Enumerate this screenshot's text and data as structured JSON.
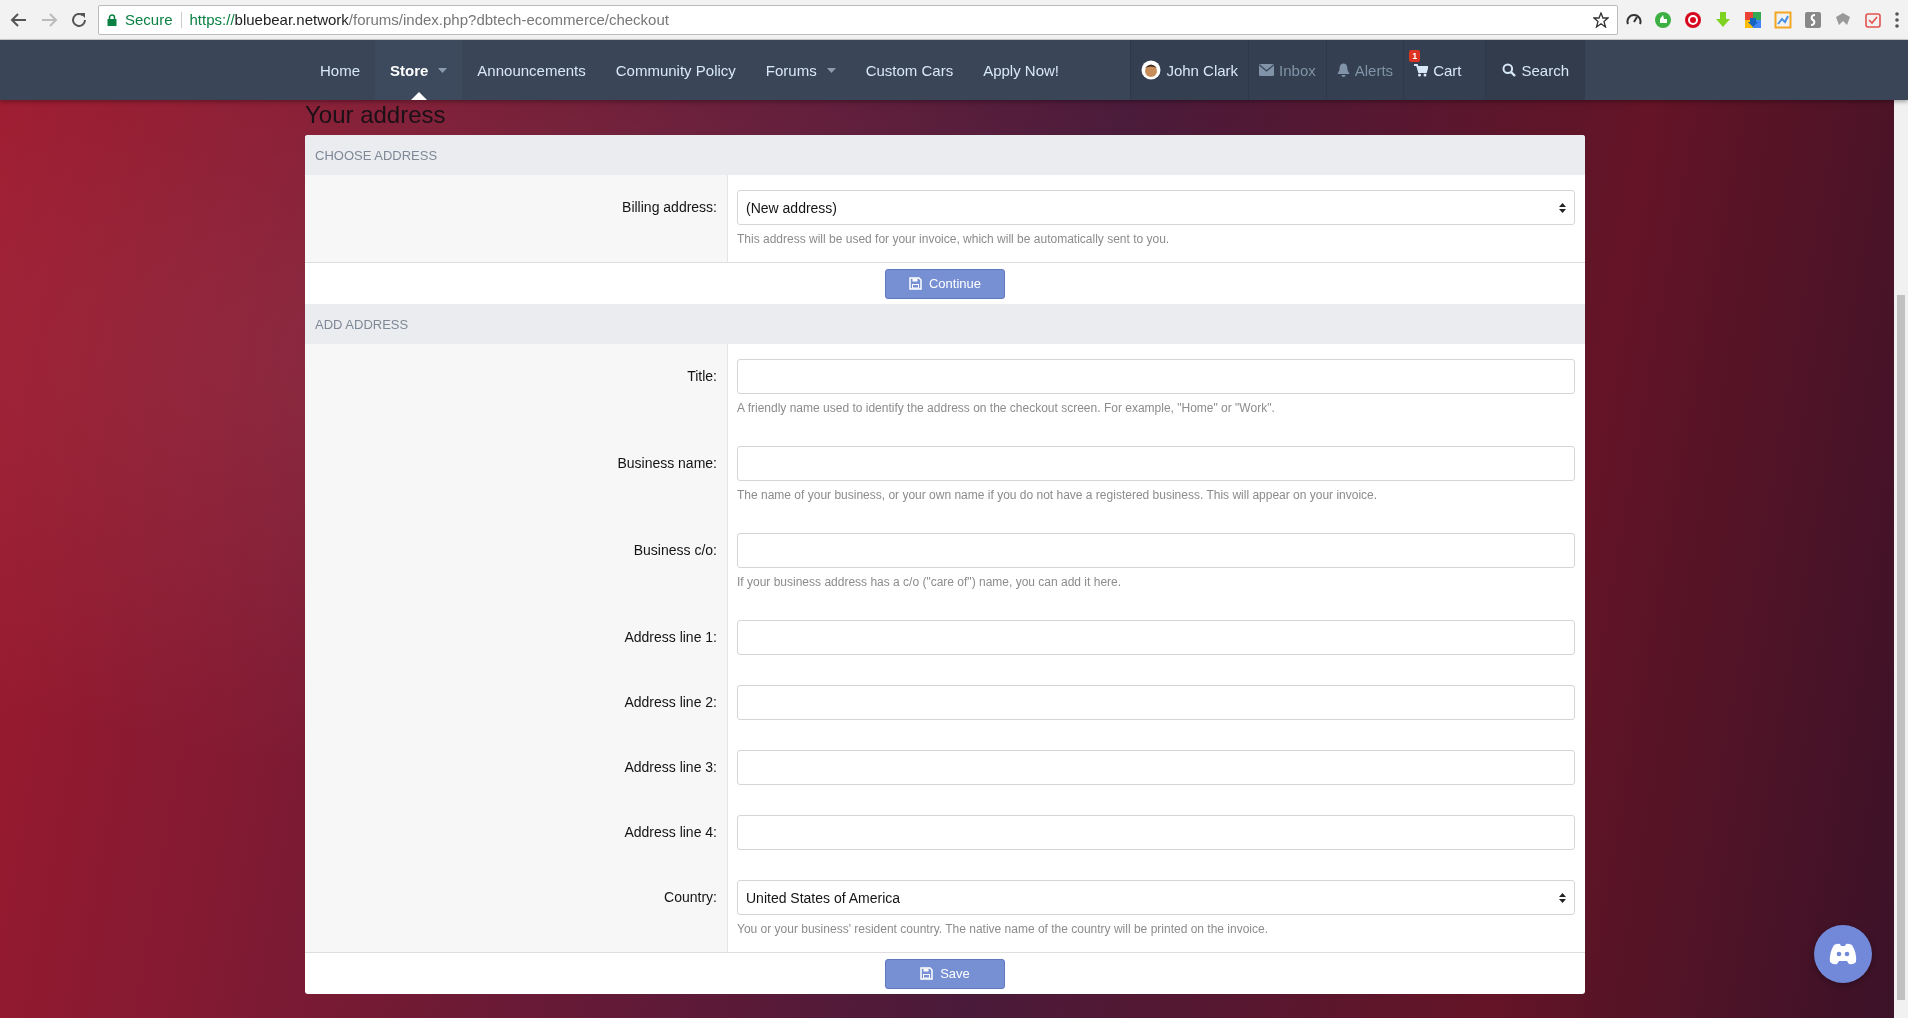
{
  "browser": {
    "secure_label": "Secure",
    "url_scheme": "https://",
    "url_host": "bluebear.network",
    "url_path": "/forums/index.php?dbtech-ecommerce/checkout"
  },
  "nav": {
    "items": [
      {
        "label": "Home",
        "selected": false,
        "caret": false
      },
      {
        "label": "Store",
        "selected": true,
        "caret": true
      },
      {
        "label": "Announcements",
        "selected": false,
        "caret": false
      },
      {
        "label": "Community Policy",
        "selected": false,
        "caret": false
      },
      {
        "label": "Forums",
        "selected": false,
        "caret": true
      },
      {
        "label": "Custom Cars",
        "selected": false,
        "caret": false
      },
      {
        "label": "Apply Now!",
        "selected": false,
        "caret": false
      }
    ],
    "account": [
      {
        "kind": "user",
        "label": "John Clark",
        "dimmed": false
      },
      {
        "kind": "inbox",
        "label": "Inbox",
        "dimmed": true
      },
      {
        "kind": "alerts",
        "label": "Alerts",
        "dimmed": true
      },
      {
        "kind": "cart",
        "label": "Cart",
        "dimmed": false,
        "badge": "1"
      },
      {
        "kind": "search",
        "label": "Search",
        "dimmed": false
      }
    ]
  },
  "page_title": "Your address",
  "sections": [
    {
      "title": "CHOOSE ADDRESS",
      "button": "Continue",
      "fields": [
        {
          "kind": "select",
          "label": "Billing address:",
          "value": "(New address)",
          "hint": "This address will be used for your invoice, which will be automatically sent to you."
        }
      ]
    },
    {
      "title": "ADD ADDRESS",
      "button": "Save",
      "fields": [
        {
          "kind": "text",
          "label": "Title:",
          "hint": "A friendly name used to identify the address on the checkout screen. For example, \"Home\" or \"Work\"."
        },
        {
          "kind": "text",
          "label": "Business name:",
          "hint": "The name of your business, or your own name if you do not have a registered business. This will appear on your invoice."
        },
        {
          "kind": "text",
          "label": "Business c/o:",
          "hint": "If your business address has a c/o (\"care of\") name, you can add it here."
        },
        {
          "kind": "text",
          "label": "Address line 1:"
        },
        {
          "kind": "text",
          "label": "Address line 2:"
        },
        {
          "kind": "text",
          "label": "Address line 3:"
        },
        {
          "kind": "text",
          "label": "Address line 4:"
        },
        {
          "kind": "select",
          "label": "Country:",
          "value": "United States of America",
          "hint": "You or your business' resident country. The native name of the country will be printed on the invoice."
        }
      ]
    }
  ]
}
